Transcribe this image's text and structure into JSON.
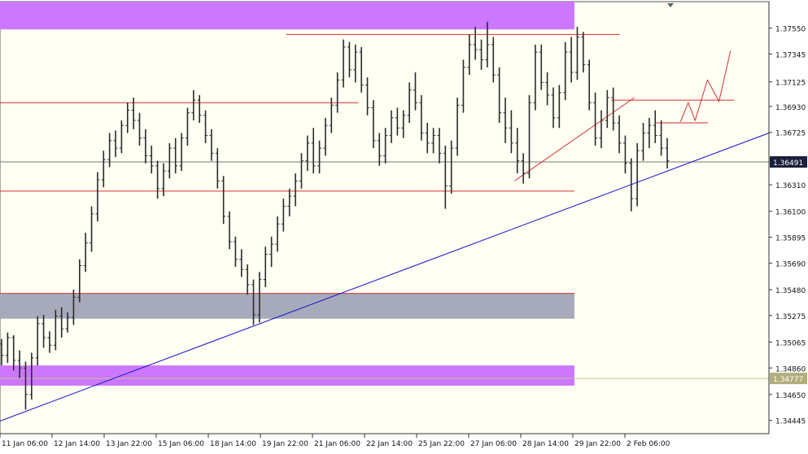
{
  "chart_data": {
    "type": "bar",
    "title": "",
    "xlabel": "",
    "ylabel": "",
    "ylim": [
      1.3434,
      1.3776
    ],
    "yticks": [
      "1.37550",
      "1.37345",
      "1.37125",
      "1.36930",
      "1.36725",
      "1.36310",
      "1.36100",
      "1.35895",
      "1.35690",
      "1.35480",
      "1.35275",
      "1.35065",
      "1.34860",
      "1.34650",
      "1.34445"
    ],
    "xticks": [
      "11 Jan 06:00",
      "12 Jan 14:00",
      "13 Jan 22:00",
      "15 Jan 06:00",
      "18 Jan 14:00",
      "19 Jan 22:00",
      "21 Jan 06:00",
      "22 Jan 14:00",
      "25 Jan 22:00",
      "27 Jan 06:00",
      "28 Jan 14:00",
      "29 Jan 22:00",
      "2 Feb 06:00"
    ],
    "current_price_label": "1.36491",
    "current_price": 1.36491,
    "secondary_price_label": "1.34777",
    "secondary_price": 1.34777,
    "colors": {
      "background": "#fffff3",
      "bars": "#2b2b2b",
      "bar_up_accent": "#2fcf2f",
      "zone_purple": "#cc77ff",
      "zone_gray": "#a6aabb",
      "support_resistance": "#d63030",
      "trendline": "#1010c8",
      "price_tag_bg": "#1a1f3a",
      "secondary_tag_bg": "#b3ad7c"
    },
    "zones": [
      {
        "name": "upper-supply-zone",
        "color": "purple",
        "from": 1.3754,
        "to": 1.3779,
        "x_end_pct": 0.747
      },
      {
        "name": "middle-gray-zone",
        "color": "gray",
        "from": 1.3525,
        "to": 1.3545,
        "x_end_pct": 0.747
      },
      {
        "name": "lower-demand-zone",
        "color": "purple",
        "from": 1.3472,
        "to": 1.3488,
        "x_end_pct": 0.747
      }
    ],
    "horizontal_lines": [
      {
        "name": "top-resistance-line",
        "price": 1.375,
        "x_start_pct": 0.372,
        "x_end_pct": 0.806
      },
      {
        "name": "mid-resistance-line",
        "price": 1.3696,
        "x_start_pct": 0.0,
        "x_end_pct": 0.466
      },
      {
        "name": "support-line",
        "price": 1.3626,
        "x_start_pct": 0.0,
        "x_end_pct": 0.747
      },
      {
        "name": "gray-zone-top-line",
        "price": 1.3545,
        "x_start_pct": 0.0,
        "x_end_pct": 0.747
      },
      {
        "name": "right-resistance-line",
        "price": 1.3698,
        "x_start_pct": 0.795,
        "x_end_pct": 0.955
      },
      {
        "name": "right-small-line",
        "price": 1.368,
        "x_start_pct": 0.853,
        "x_end_pct": 0.921
      }
    ],
    "trendlines": [
      {
        "name": "blue-rising-trendline",
        "color": "blue",
        "p1": [
          0.0,
          1.3444
        ],
        "p2": [
          1.0,
          1.3672
        ]
      },
      {
        "name": "red-rising-trendline",
        "color": "red",
        "p1": [
          0.669,
          1.3634
        ],
        "p2": [
          0.825,
          1.37
        ]
      }
    ],
    "projection": [
      [
        0.885,
        1.3681
      ],
      [
        0.895,
        1.3696
      ],
      [
        0.904,
        1.3682
      ],
      [
        0.92,
        1.3714
      ],
      [
        0.935,
        1.3697
      ],
      [
        0.95,
        1.3737
      ]
    ],
    "series": [
      {
        "ohlc": [
          [
            1.3505,
            1.3509,
            1.3488,
            1.3496
          ],
          [
            1.3496,
            1.3514,
            1.349,
            1.351
          ],
          [
            1.351,
            1.3512,
            1.3484,
            1.3492
          ],
          [
            1.3492,
            1.35,
            1.3478,
            1.3486
          ],
          [
            1.3486,
            1.3491,
            1.3453,
            1.3465
          ],
          [
            1.3465,
            1.3498,
            1.3461,
            1.3494
          ],
          [
            1.3494,
            1.3527,
            1.3488,
            1.3521
          ],
          [
            1.3521,
            1.3528,
            1.3502,
            1.351
          ],
          [
            1.351,
            1.3515,
            1.3498,
            1.3504
          ],
          [
            1.3504,
            1.3532,
            1.35,
            1.3527
          ],
          [
            1.3527,
            1.3534,
            1.351,
            1.3517
          ],
          [
            1.3517,
            1.353,
            1.3514,
            1.3526
          ],
          [
            1.3526,
            1.3548,
            1.352,
            1.3542
          ],
          [
            1.3542,
            1.3572,
            1.3538,
            1.3567
          ],
          [
            1.3567,
            1.3593,
            1.3562,
            1.3585
          ],
          [
            1.3585,
            1.3614,
            1.3578,
            1.3608
          ],
          [
            1.3608,
            1.3641,
            1.3602,
            1.3635
          ],
          [
            1.3635,
            1.3658,
            1.3629,
            1.3651
          ],
          [
            1.3651,
            1.3672,
            1.3645,
            1.3666
          ],
          [
            1.3666,
            1.3674,
            1.3653,
            1.366
          ],
          [
            1.366,
            1.3682,
            1.3656,
            1.3678
          ],
          [
            1.3678,
            1.3696,
            1.3672,
            1.369
          ],
          [
            1.369,
            1.37,
            1.3675,
            1.3682
          ],
          [
            1.3682,
            1.3688,
            1.3662,
            1.3668
          ],
          [
            1.3668,
            1.3675,
            1.3648,
            1.3654
          ],
          [
            1.3654,
            1.3662,
            1.364,
            1.3646
          ],
          [
            1.3646,
            1.365,
            1.362,
            1.3628
          ],
          [
            1.3628,
            1.3648,
            1.3622,
            1.3642
          ],
          [
            1.3642,
            1.3664,
            1.3636,
            1.366
          ],
          [
            1.366,
            1.3668,
            1.364,
            1.3646
          ],
          [
            1.3646,
            1.3672,
            1.3642,
            1.3668
          ],
          [
            1.3668,
            1.3692,
            1.3662,
            1.3688
          ],
          [
            1.3688,
            1.3706,
            1.3682,
            1.3698
          ],
          [
            1.3698,
            1.3702,
            1.368,
            1.3686
          ],
          [
            1.3686,
            1.369,
            1.3664,
            1.367
          ],
          [
            1.367,
            1.3675,
            1.365,
            1.3656
          ],
          [
            1.3656,
            1.366,
            1.3628,
            1.3634
          ],
          [
            1.3634,
            1.3638,
            1.36,
            1.3606
          ],
          [
            1.3606,
            1.361,
            1.358,
            1.3586
          ],
          [
            1.3586,
            1.359,
            1.3566,
            1.3572
          ],
          [
            1.3572,
            1.358,
            1.3558,
            1.3564
          ],
          [
            1.3564,
            1.3568,
            1.3544,
            1.3552
          ],
          [
            1.3552,
            1.3556,
            1.352,
            1.3528
          ],
          [
            1.3528,
            1.3562,
            1.3522,
            1.3556
          ],
          [
            1.3556,
            1.3582,
            1.355,
            1.3576
          ],
          [
            1.3576,
            1.359,
            1.3566,
            1.3584
          ],
          [
            1.3584,
            1.3606,
            1.3578,
            1.36
          ],
          [
            1.36,
            1.362,
            1.3594,
            1.3614
          ],
          [
            1.3614,
            1.3628,
            1.3606,
            1.3622
          ],
          [
            1.3622,
            1.364,
            1.3614,
            1.3634
          ],
          [
            1.3634,
            1.3656,
            1.3628,
            1.365
          ],
          [
            1.365,
            1.367,
            1.3642,
            1.3664
          ],
          [
            1.3664,
            1.3676,
            1.364,
            1.3646
          ],
          [
            1.3646,
            1.3666,
            1.364,
            1.366
          ],
          [
            1.366,
            1.3684,
            1.3654,
            1.3678
          ],
          [
            1.3678,
            1.37,
            1.3672,
            1.3694
          ],
          [
            1.3694,
            1.372,
            1.3688,
            1.3714
          ],
          [
            1.3714,
            1.3746,
            1.3708,
            1.374
          ],
          [
            1.374,
            1.3744,
            1.3716,
            1.3722
          ],
          [
            1.3722,
            1.3742,
            1.3712,
            1.3736
          ],
          [
            1.3736,
            1.374,
            1.3704,
            1.371
          ],
          [
            1.371,
            1.3716,
            1.3686,
            1.3692
          ],
          [
            1.3692,
            1.3698,
            1.366,
            1.3666
          ],
          [
            1.3666,
            1.3672,
            1.3646,
            1.3654
          ],
          [
            1.3654,
            1.3676,
            1.3648,
            1.367
          ],
          [
            1.367,
            1.369,
            1.3664,
            1.3684
          ],
          [
            1.3684,
            1.3692,
            1.367,
            1.3676
          ],
          [
            1.3676,
            1.369,
            1.3668,
            1.3686
          ],
          [
            1.3686,
            1.3712,
            1.368,
            1.3706
          ],
          [
            1.3706,
            1.372,
            1.369,
            1.3696
          ],
          [
            1.3696,
            1.3702,
            1.3666,
            1.3672
          ],
          [
            1.3672,
            1.368,
            1.3656,
            1.3664
          ],
          [
            1.3664,
            1.3676,
            1.3656,
            1.367
          ],
          [
            1.367,
            1.3676,
            1.3648,
            1.3656
          ],
          [
            1.3656,
            1.3662,
            1.3612,
            1.363
          ],
          [
            1.363,
            1.3666,
            1.3624,
            1.366
          ],
          [
            1.366,
            1.37,
            1.3654,
            1.3694
          ],
          [
            1.3694,
            1.373,
            1.3688,
            1.3724
          ],
          [
            1.3724,
            1.375,
            1.3718,
            1.3742
          ],
          [
            1.3742,
            1.3756,
            1.373,
            1.3738
          ],
          [
            1.3738,
            1.3746,
            1.3722,
            1.373
          ],
          [
            1.373,
            1.376,
            1.3724,
            1.3742
          ],
          [
            1.3742,
            1.3748,
            1.3712,
            1.3718
          ],
          [
            1.3718,
            1.3724,
            1.368,
            1.3688
          ],
          [
            1.3688,
            1.37,
            1.3664,
            1.3676
          ],
          [
            1.3676,
            1.369,
            1.3656,
            1.3664
          ],
          [
            1.3664,
            1.3676,
            1.364,
            1.365
          ],
          [
            1.365,
            1.3656,
            1.3632,
            1.364
          ],
          [
            1.364,
            1.3702,
            1.3636,
            1.3696
          ],
          [
            1.3696,
            1.3742,
            1.369,
            1.3736
          ],
          [
            1.3736,
            1.3742,
            1.3706,
            1.3712
          ],
          [
            1.3712,
            1.372,
            1.3694,
            1.3702
          ],
          [
            1.3702,
            1.3708,
            1.3676,
            1.3684
          ],
          [
            1.3684,
            1.371,
            1.3676,
            1.3704
          ],
          [
            1.3704,
            1.3744,
            1.3698,
            1.3736
          ],
          [
            1.3736,
            1.3748,
            1.3712,
            1.372
          ],
          [
            1.372,
            1.3756,
            1.3714,
            1.3748
          ],
          [
            1.3748,
            1.3752,
            1.372,
            1.3726
          ],
          [
            1.3726,
            1.373,
            1.369,
            1.3696
          ],
          [
            1.3696,
            1.3704,
            1.3662,
            1.3668
          ],
          [
            1.3668,
            1.369,
            1.366,
            1.3682
          ],
          [
            1.3682,
            1.3706,
            1.3676,
            1.37
          ],
          [
            1.37,
            1.3708,
            1.3674,
            1.368
          ],
          [
            1.368,
            1.3686,
            1.3656,
            1.3664
          ],
          [
            1.3664,
            1.367,
            1.364,
            1.3648
          ],
          [
            1.3648,
            1.3652,
            1.361,
            1.362
          ],
          [
            1.362,
            1.3664,
            1.3614,
            1.3658
          ],
          [
            1.3658,
            1.368,
            1.365,
            1.3672
          ],
          [
            1.3672,
            1.3684,
            1.366,
            1.3678
          ],
          [
            1.3678,
            1.369,
            1.3664,
            1.367
          ],
          [
            1.367,
            1.3682,
            1.3654,
            1.366
          ],
          [
            1.366,
            1.3668,
            1.3644,
            1.365
          ]
        ]
      }
    ]
  }
}
